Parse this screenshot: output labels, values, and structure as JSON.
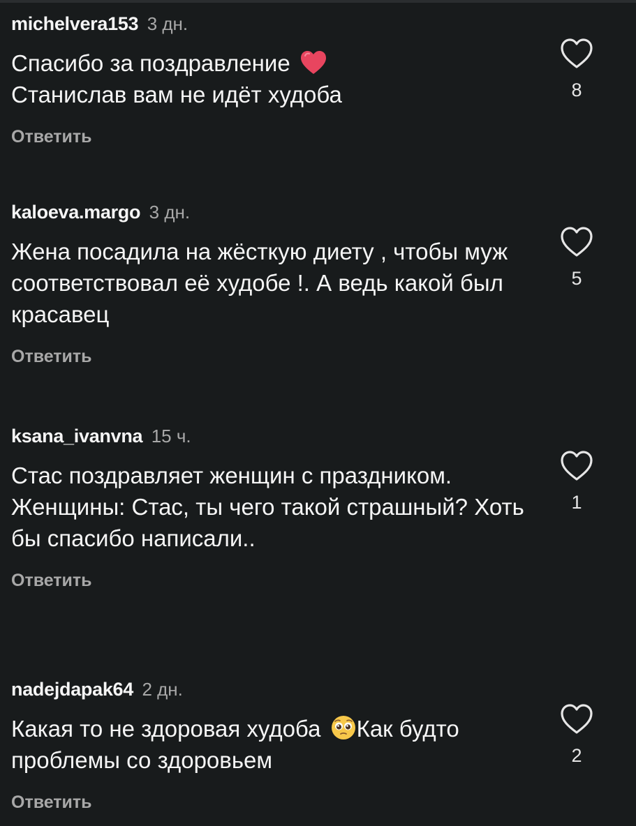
{
  "comments": [
    {
      "username": "michelvera153",
      "time": "3 дн.",
      "text_line1": "Спасибо за поздравление",
      "text_line2": "Станислав вам не идёт худоба",
      "emoji": "heart-emoji",
      "reply_label": "Ответить",
      "likes": "8"
    },
    {
      "username": "kaloeva.margo",
      "time": "3 дн.",
      "text": "Жена посадила на жёсткую диету , чтобы муж соответствовал её худобе !. А ведь какой был красавец",
      "reply_label": "Ответить",
      "likes": "5"
    },
    {
      "username": "ksana_ivanvna",
      "time": "15 ч.",
      "text": "Стас поздравляет женщин с праздником. Женщины: Стас, ты чего такой страшный? Хоть бы спасибо написали..",
      "reply_label": "Ответить",
      "likes": "1"
    },
    {
      "username": "nadejdapak64",
      "time": "2 дн.",
      "text_part1": "Какая то не здоровая худоба",
      "text_part2": "Как будто проблемы со здоровьем",
      "emoji": "pleading-face-emoji",
      "reply_label": "Ответить",
      "likes": "2"
    }
  ],
  "icons": {
    "like": "heart-outline-icon"
  },
  "colors": {
    "background": "#181b1c",
    "text": "#f5f5f5",
    "secondary_text": "#a8a8a8",
    "heart_emoji": "#e8455f"
  }
}
